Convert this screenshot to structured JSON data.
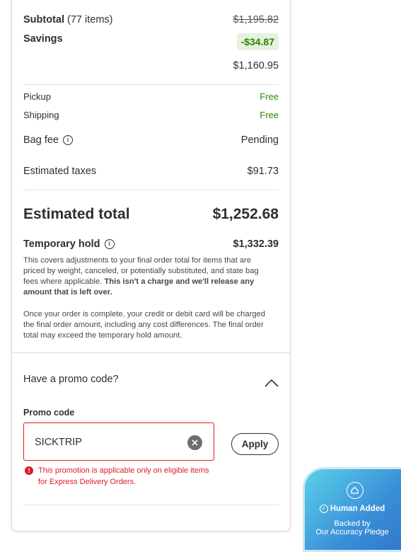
{
  "summary": {
    "subtotal_label": "Subtotal",
    "subtotal_items": "(77 items)",
    "subtotal_original": "$1,195.82",
    "savings_label": "Savings",
    "savings_value": "-$34.87",
    "subtotal_after_savings": "$1,160.95",
    "pickup_label": "Pickup",
    "pickup_value": "Free",
    "shipping_label": "Shipping",
    "shipping_value": "Free",
    "bag_fee_label": "Bag fee",
    "bag_fee_value": "Pending",
    "taxes_label": "Estimated taxes",
    "taxes_value": "$91.73",
    "total_label": "Estimated total",
    "total_value": "$1,252.68"
  },
  "hold": {
    "label": "Temporary hold",
    "value": "$1,332.39",
    "para1_text": "This covers adjustments to your final order total for items that are priced by weight, canceled, or potentially substituted, and state bag fees where applicable.",
    "para1_bold": "This isn't a charge and we'll release any amount that is left over.",
    "para2": "Once your order is complete, your credit or debit card will be charged the final order amount, including any cost differences. The final order total may exceed the temporary hold amount."
  },
  "promo": {
    "heading": "Have a promo code?",
    "field_label": "Promo code",
    "value": "SICKTRIP",
    "apply_label": "Apply",
    "error": "This promotion is applicable only on eligible items for Express Delivery Orders."
  },
  "badge": {
    "title": "Human Added",
    "line1": "Backed by",
    "line2": "Our Accuracy Pledge"
  },
  "icons": {
    "info": "info-icon",
    "chevron": "chevron-up-icon",
    "clear": "clear-icon",
    "error": "error-icon",
    "house": "house-icon",
    "check": "check-circle-icon"
  },
  "colors": {
    "green": "#2a8703",
    "error": "#de1c24",
    "badge_gradient_start": "#5ad1e8",
    "badge_gradient_end": "#2f76c9"
  }
}
